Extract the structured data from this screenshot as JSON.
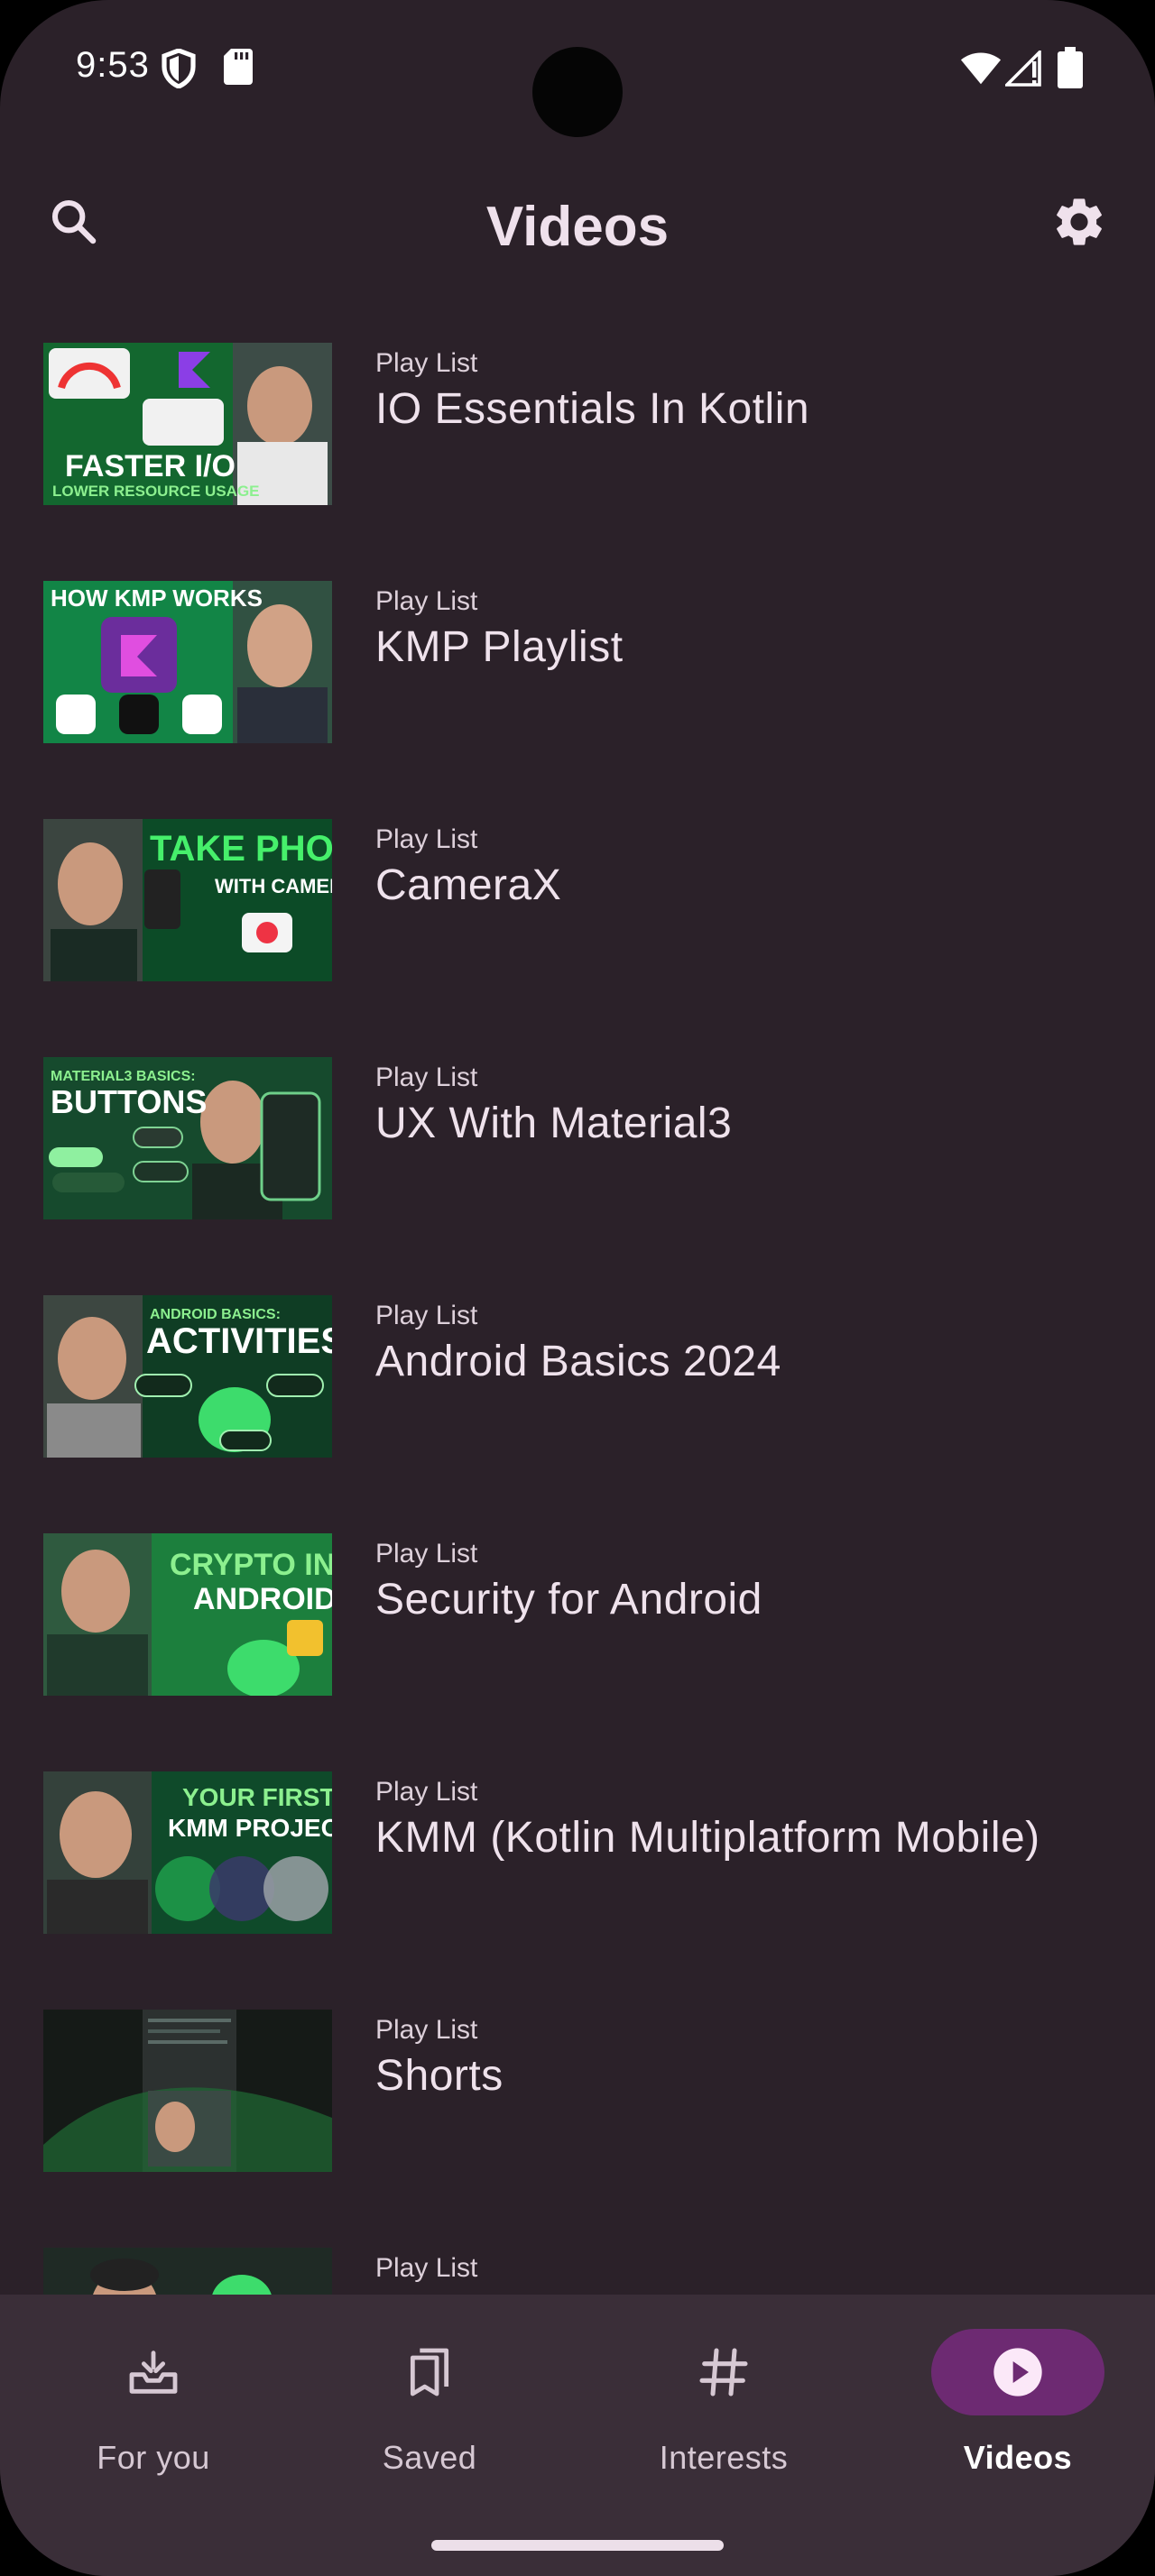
{
  "status_bar": {
    "time": "9:53"
  },
  "top_bar": {
    "title": "Videos"
  },
  "playlists": [
    {
      "kind": "Play List",
      "title": "IO Essentials In Kotlin",
      "thumb_text": "FASTER I/O",
      "thumb_sub": "LOWER RESOURCE USAGE"
    },
    {
      "kind": "Play List",
      "title": "KMP Playlist",
      "thumb_text": "HOW KMP WORKS",
      "thumb_sub": ""
    },
    {
      "kind": "Play List",
      "title": "CameraX",
      "thumb_text": "TAKE PHOTOS",
      "thumb_sub": "WITH CAMERAX"
    },
    {
      "kind": "Play List",
      "title": "UX With Material3",
      "thumb_text": "BUTTONS",
      "thumb_sub": "MATERIAL3 BASICS:"
    },
    {
      "kind": "Play List",
      "title": "Android Basics 2024",
      "thumb_text": "ACTIVITIES",
      "thumb_sub": "ANDROID BASICS:"
    },
    {
      "kind": "Play List",
      "title": "Security for Android",
      "thumb_text": "CRYPTO IN",
      "thumb_sub": "ANDROID"
    },
    {
      "kind": "Play List",
      "title": "KMM (Kotlin Multiplatform Mobile)",
      "thumb_text": "YOUR FIRST",
      "thumb_sub": "KMM PROJECT"
    },
    {
      "kind": "Play List",
      "title": "Shorts",
      "thumb_text": "",
      "thumb_sub": ""
    },
    {
      "kind": "Play List",
      "title": "",
      "thumb_text": "",
      "thumb_sub": ""
    }
  ],
  "bottom_nav": {
    "items": [
      {
        "label": "For you",
        "icon": "inbox-upcoming-icon",
        "active": false
      },
      {
        "label": "Saved",
        "icon": "bookmarks-icon",
        "active": false
      },
      {
        "label": "Interests",
        "icon": "hashtag-icon",
        "active": false
      },
      {
        "label": "Videos",
        "icon": "play-circle-icon",
        "active": true
      }
    ]
  },
  "colors": {
    "background": "#2b2129",
    "nav_background": "#3a2e38",
    "active_pill": "#6d2a72",
    "thumb_green": "#1f9e4b"
  }
}
